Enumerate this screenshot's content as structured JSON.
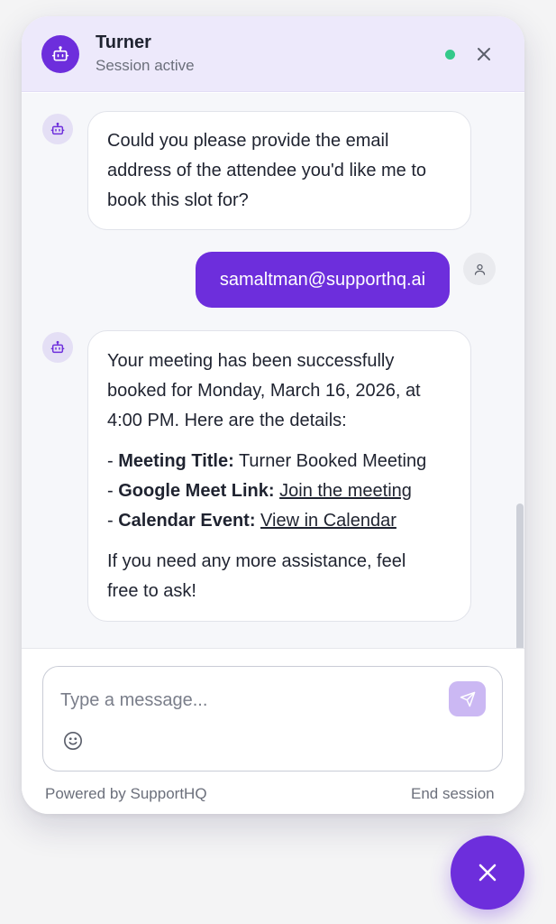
{
  "header": {
    "name": "Turner",
    "status": "Session active",
    "online_color": "#34c98a",
    "close_icon": "close-icon",
    "avatar_icon": "robot-icon"
  },
  "messages": [
    {
      "sender": "bot",
      "lines": [
        "Could you please provide the email",
        "address of the attendee you'd like me to",
        "book this slot for?"
      ]
    },
    {
      "sender": "user",
      "text": "samaltman@supporthq.ai"
    },
    {
      "sender": "bot",
      "intro_lines": [
        "Your meeting has been successfully",
        "booked for Monday, March 16, 2026, at",
        "4:00 PM. Here are the details:"
      ],
      "details": [
        {
          "prefix": "- ",
          "label": "Meeting Title:",
          "value": "Turner Booked Meeting"
        },
        {
          "prefix": "- ",
          "label": "Google Meet Link:",
          "link": "Join the meeting"
        },
        {
          "prefix": "- ",
          "label": "Calendar Event:",
          "link": "View in Calendar"
        }
      ],
      "outro_lines": [
        "If you need any more assistance, feel",
        "free to ask!"
      ]
    }
  ],
  "composer": {
    "placeholder": "Type a message...",
    "send_icon": "send-icon",
    "emoji_icon": "emoji-icon"
  },
  "footer": {
    "powered_by": "Powered by SupportHQ",
    "end_session": "End session"
  },
  "colors": {
    "brand": "#6d2edc",
    "header_bg": "#ede9fb",
    "send_disabled": "#cbb8f3"
  }
}
